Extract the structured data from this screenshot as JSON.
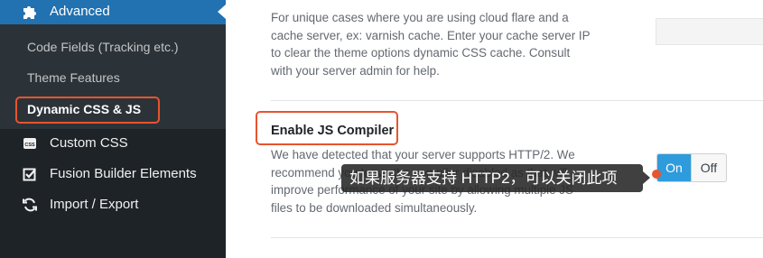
{
  "sidebar": {
    "active_menu": {
      "label": "Advanced",
      "icon": "puzzle-icon"
    },
    "submenu": [
      {
        "label": "Code Fields (Tracking etc.)"
      },
      {
        "label": "Theme Features"
      },
      {
        "label": "Dynamic CSS & JS",
        "current": true
      }
    ],
    "menu_items": [
      {
        "label": "Custom CSS",
        "icon": "css-file-icon"
      },
      {
        "label": "Fusion Builder Elements",
        "icon": "checkbox-icon"
      },
      {
        "label": "Import / Export",
        "icon": "refresh-icon"
      }
    ]
  },
  "main": {
    "cache_server_description": [
      "For unique cases where you are using cloud flare and a",
      "cache server, ex: varnish cache. Enter your cache server IP",
      "to clear the theme options dynamic CSS cache. Consult",
      "with your server admin for help."
    ],
    "js_compiler": {
      "title": "Enable JS Compiler",
      "description": [
        "We have detected that your server supports HTTP/2. We",
        "recommend you leave the compiler disabled as that will",
        "improve performance of your site by allowing multiple JS",
        "files to be downloaded simultaneously."
      ],
      "toggle": {
        "on_label": "On",
        "off_label": "Off",
        "selected": "On"
      }
    },
    "tooltip": "如果服务器支持 HTTP2，可以关闭此项"
  },
  "colors": {
    "sidebar_bg": "#1e2327",
    "submenu_bg": "#2c3338",
    "active_menu_bg": "#2271b1",
    "toggle_on_bg": "#2e9bdc",
    "annotation_red": "#e8542e"
  }
}
